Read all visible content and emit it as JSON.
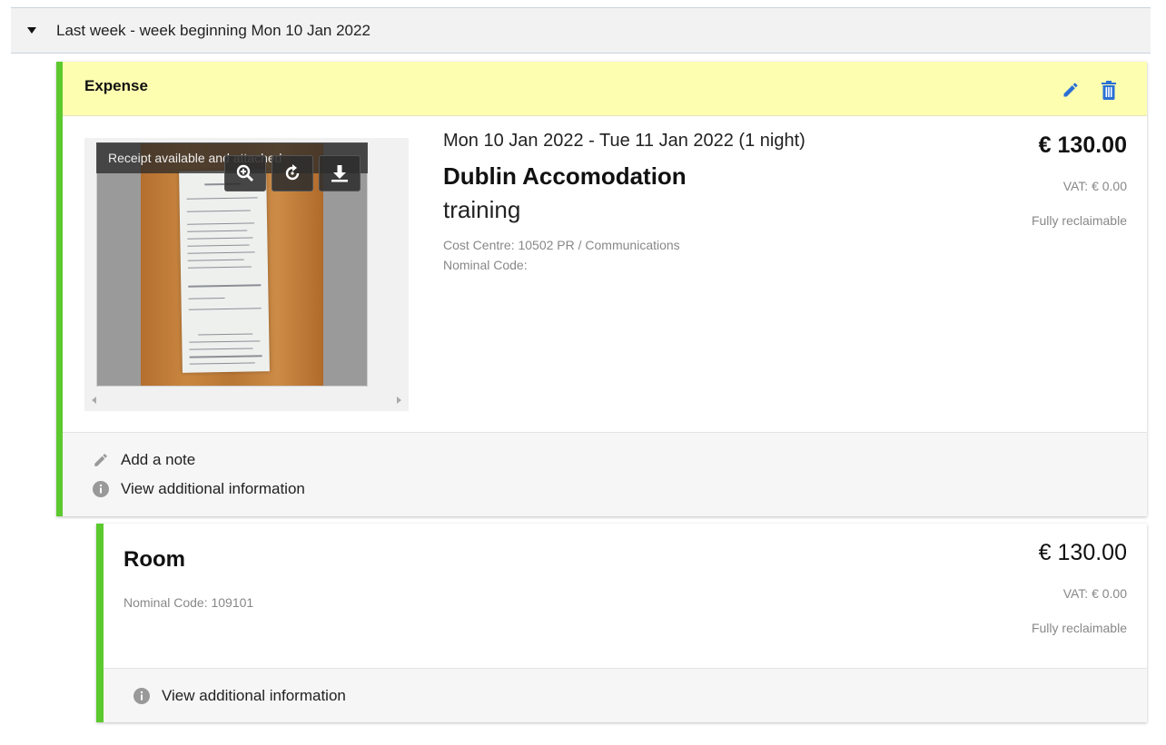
{
  "week": {
    "title": "Last week - week beginning Mon 10 Jan 2022"
  },
  "expense": {
    "type_label": "Expense",
    "receipt_caption": "Receipt available and attached",
    "dates": "Mon 10 Jan 2022 - Tue 11 Jan 2022 (1 night)",
    "merchant": "Dublin Accomodation",
    "purpose": "training",
    "cost_centre": "Cost Centre: 10502 PR / Communications",
    "nominal_code": "Nominal Code:",
    "amount": "€ 130.00",
    "vat": "VAT: € 0.00",
    "reclaim": "Fully reclaimable",
    "add_note": "Add a note",
    "view_info": "View additional information"
  },
  "room": {
    "name": "Room",
    "nominal_code": "Nominal Code: 109101",
    "amount": "€ 130.00",
    "vat": "VAT: € 0.00",
    "reclaim": "Fully reclaimable",
    "view_info": "View additional information"
  },
  "colors": {
    "accent_green": "#5cc92e",
    "header_yellow": "#fefeb1",
    "icon_blue": "#2a6fd6"
  },
  "icons": {
    "collapse": "caret-down-icon",
    "edit": "pencil-icon",
    "delete": "trash-icon",
    "zoom": "zoom-in-icon",
    "rotate": "rotate-icon",
    "download": "download-icon",
    "note": "pencil-icon",
    "info": "info-icon"
  }
}
